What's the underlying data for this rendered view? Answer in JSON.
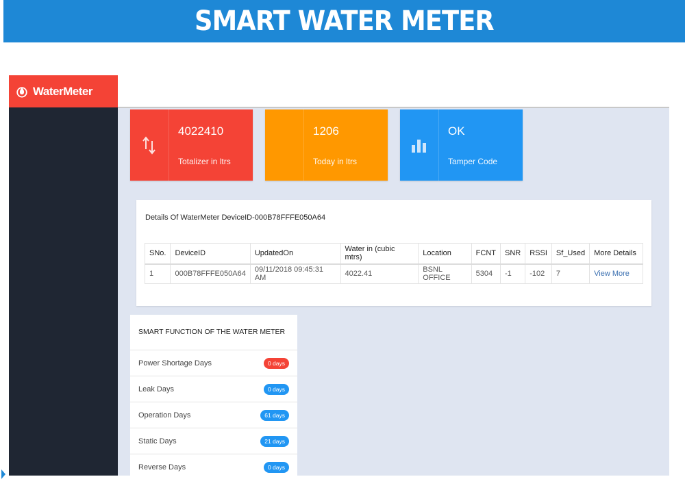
{
  "banner": {
    "title": "SMART WATER METER"
  },
  "brand": {
    "name": "WaterMeter"
  },
  "cards": [
    {
      "value": "4022410",
      "label": "Totalizer in ltrs",
      "icon": "arrows-up-down-icon",
      "color": "#f44336"
    },
    {
      "value": "1206",
      "label": "Today in ltrs",
      "icon": "",
      "color": "#ff9800"
    },
    {
      "value": "OK",
      "label": "Tamper Code",
      "icon": "bar-chart-icon",
      "color": "#2196f3"
    }
  ],
  "details": {
    "title": "Details Of WaterMeter DeviceID-000B78FFFE050A64",
    "columns": [
      "SNo.",
      "DeviceID",
      "UpdatedOn",
      "Water in (cubic mtrs)",
      "Location",
      "FCNT",
      "SNR",
      "RSSI",
      "Sf_Used",
      "More Details"
    ],
    "rows": [
      [
        "1",
        "000B78FFFE050A64",
        "09/11/2018 09:45:31 AM",
        "4022.41",
        "BSNL OFFICE",
        "5304",
        "-1",
        "-102",
        "7",
        "View More"
      ]
    ]
  },
  "smart": {
    "title": "SMART FUNCTION OF THE WATER METER",
    "items": [
      {
        "label": "Power Shortage Days",
        "badge": "0 days",
        "status": "red"
      },
      {
        "label": "Leak Days",
        "badge": "0 days",
        "status": "blue"
      },
      {
        "label": "Operation Days",
        "badge": "61 days",
        "status": "blue"
      },
      {
        "label": "Static Days",
        "badge": "21 days",
        "status": "blue"
      },
      {
        "label": "Reverse Days",
        "badge": "0 days",
        "status": "blue"
      }
    ]
  }
}
